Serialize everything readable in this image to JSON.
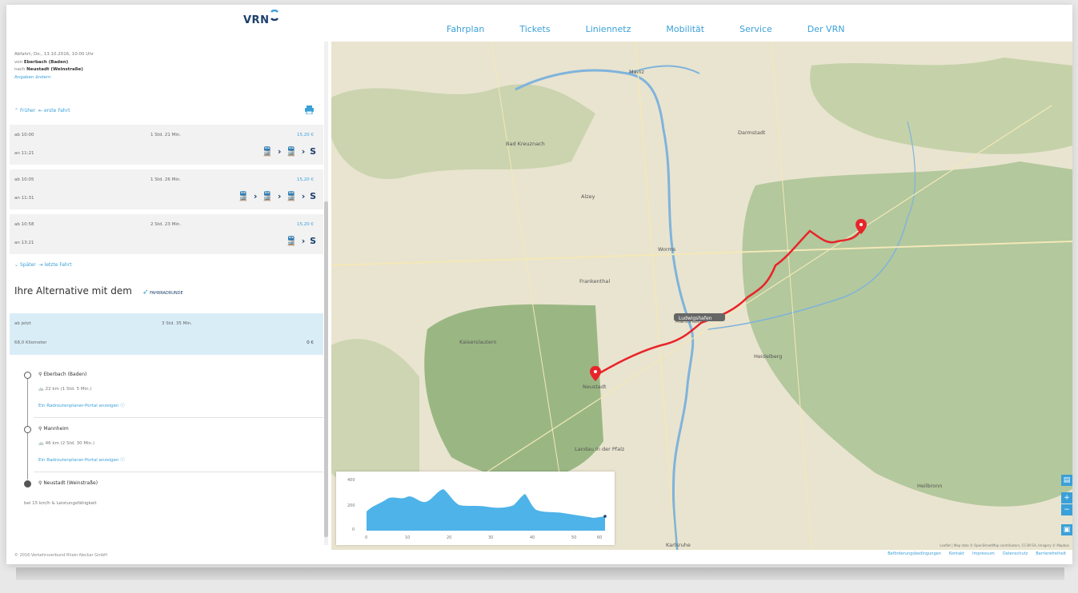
{
  "header": {
    "logo": "VRN",
    "nav": [
      "Fahrplan",
      "Tickets",
      "Liniennetz",
      "Mobilität",
      "Service",
      "Der VRN"
    ]
  },
  "search": {
    "date_line": "Abfahrt, Do., 13.10.2016, 10:00 Uhr",
    "from_prefix": "von",
    "from": "Eberbach (Baden)",
    "to_prefix": "nach",
    "to": "Neustadt (Weinstraße)",
    "edit_link": "Angaben ändern",
    "earlier": "Früher",
    "first_trip": "erste Fahrt"
  },
  "connections": [
    {
      "depart": "ab 10:00",
      "arrive": "an 11:21",
      "duration": "1 Std. 21 Min.",
      "price": "15,20 €",
      "modes": "🚆 › 🚆 › S"
    },
    {
      "depart": "ab 10:05",
      "arrive": "an 11:31",
      "duration": "1 Std. 26 Min.",
      "price": "15,20 €",
      "modes": "🚆 › 🚆 › 🚆 › S"
    },
    {
      "depart": "ab 10:58",
      "arrive": "an 13:21",
      "duration": "2 Std. 23 Min.",
      "price": "15,20 €",
      "modes": "🚆 › S"
    }
  ],
  "later": {
    "later": "Später",
    "last_trip": "letzte Fahrt"
  },
  "alternative": {
    "title": "Ihre Alternative mit dem",
    "brand": "FAHRRADRUNDE",
    "depart": "ab jetzt",
    "duration": "3 Std. 35 Min.",
    "distance": "68,0 Kilometer",
    "price": "0 €"
  },
  "route": [
    {
      "name": "Eberbach (Baden)",
      "sub": "🚲 22 km (1 Std. 5 Min.)",
      "link": "Ein Radroutenplaner-Portal anzeigen ⓘ"
    },
    {
      "name": "Mannheim",
      "sub": "🚲 46 km (2 Std. 30 Min.)",
      "link": "Ein Radroutenplaner-Portal anzeigen ⓘ"
    },
    {
      "name": "Neustadt (Weinstraße)",
      "sub": "",
      "link": ""
    }
  ],
  "route_footnote": "bei 15 km/h & Leistungsfähigkeit",
  "copyright": "© 2016 Verkehrsverbund Rhein-Neckar GmbH",
  "map": {
    "cities": [
      {
        "name": "Mainz"
      },
      {
        "name": "Darmstadt"
      },
      {
        "name": "Bad Kreuznach"
      },
      {
        "name": "Worms"
      },
      {
        "name": "Kaiserslautern"
      },
      {
        "name": "Mannheim"
      },
      {
        "name": "Heidelberg"
      },
      {
        "name": "Neustadt"
      },
      {
        "name": "Landau in der Pfalz"
      },
      {
        "name": "Heilbronn"
      },
      {
        "name": "Karlsruhe"
      },
      {
        "name": "Alzey"
      },
      {
        "name": "Frankenthal"
      }
    ],
    "route_label": "Ludwigshafen",
    "attribution": "Leaflet | Map data © OpenStreetMap contributors, CC-BY-SA, Imagery © Mapbox"
  },
  "elevation": {
    "y_ticks": [
      "400",
      "200",
      "0"
    ],
    "x_ticks": [
      "0",
      "10",
      "20",
      "30",
      "40",
      "50",
      "60"
    ]
  },
  "footer_links": [
    "Beförderungsbedingungen",
    "Kontakt",
    "Impressum",
    "Datenschutz",
    "Barrierefreiheit"
  ],
  "colors": {
    "accent": "#3aa0d8",
    "route": "#e8242a",
    "alt_bg": "#d9edf7",
    "conn_bg": "#f2f2f2"
  }
}
